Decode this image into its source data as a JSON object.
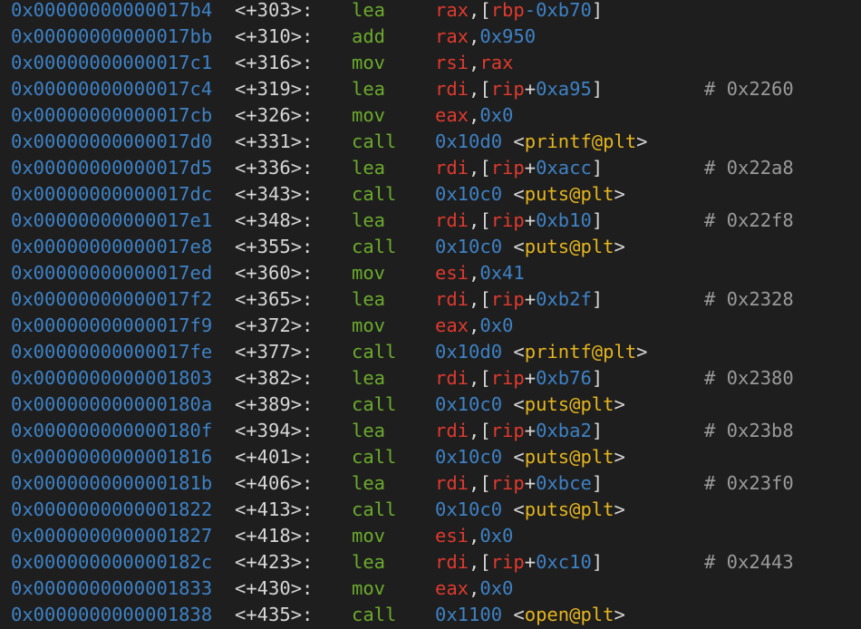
{
  "colors": {
    "background": "#1e1e1e",
    "address": "#3e82c6",
    "offset": "#d6d6d6",
    "mnemonic": "#6bab2c",
    "register": "#e03a2e",
    "number": "#3e82c6",
    "symbol": "#e5b51e",
    "comment": "#9a9a9a"
  },
  "lines": [
    {
      "addr": "0x00000000000017b4",
      "off": "<+303>:",
      "mn": "lea",
      "ops": [
        [
          "reg",
          "rax"
        ],
        [
          "punc",
          ",["
        ],
        [
          "reg",
          "rbp"
        ],
        [
          "num",
          "-0xb70"
        ],
        [
          "punc",
          "]"
        ]
      ],
      "cmt": ""
    },
    {
      "addr": "0x00000000000017bb",
      "off": "<+310>:",
      "mn": "add",
      "ops": [
        [
          "reg",
          "rax"
        ],
        [
          "punc",
          ","
        ],
        [
          "num",
          "0x950"
        ]
      ],
      "cmt": ""
    },
    {
      "addr": "0x00000000000017c1",
      "off": "<+316>:",
      "mn": "mov",
      "ops": [
        [
          "reg",
          "rsi"
        ],
        [
          "punc",
          ","
        ],
        [
          "reg",
          "rax"
        ]
      ],
      "cmt": ""
    },
    {
      "addr": "0x00000000000017c4",
      "off": "<+319>:",
      "mn": "lea",
      "ops": [
        [
          "reg",
          "rdi"
        ],
        [
          "punc",
          ",["
        ],
        [
          "reg",
          "rip"
        ],
        [
          "punc",
          "+"
        ],
        [
          "num",
          "0xa95"
        ],
        [
          "punc",
          "]"
        ]
      ],
      "cmt": "# 0x2260"
    },
    {
      "addr": "0x00000000000017cb",
      "off": "<+326>:",
      "mn": "mov",
      "ops": [
        [
          "reg",
          "eax"
        ],
        [
          "punc",
          ","
        ],
        [
          "num",
          "0x0"
        ]
      ],
      "cmt": ""
    },
    {
      "addr": "0x00000000000017d0",
      "off": "<+331>:",
      "mn": "call",
      "ops": [
        [
          "num",
          "0x10d0"
        ],
        [
          "punc",
          " <"
        ],
        [
          "sym",
          "printf@plt"
        ],
        [
          "punc",
          ">"
        ]
      ],
      "cmt": ""
    },
    {
      "addr": "0x00000000000017d5",
      "off": "<+336>:",
      "mn": "lea",
      "ops": [
        [
          "reg",
          "rdi"
        ],
        [
          "punc",
          ",["
        ],
        [
          "reg",
          "rip"
        ],
        [
          "punc",
          "+"
        ],
        [
          "num",
          "0xacc"
        ],
        [
          "punc",
          "]"
        ]
      ],
      "cmt": "# 0x22a8"
    },
    {
      "addr": "0x00000000000017dc",
      "off": "<+343>:",
      "mn": "call",
      "ops": [
        [
          "num",
          "0x10c0"
        ],
        [
          "punc",
          " <"
        ],
        [
          "sym",
          "puts@plt"
        ],
        [
          "punc",
          ">"
        ]
      ],
      "cmt": ""
    },
    {
      "addr": "0x00000000000017e1",
      "off": "<+348>:",
      "mn": "lea",
      "ops": [
        [
          "reg",
          "rdi"
        ],
        [
          "punc",
          ",["
        ],
        [
          "reg",
          "rip"
        ],
        [
          "punc",
          "+"
        ],
        [
          "num",
          "0xb10"
        ],
        [
          "punc",
          "]"
        ]
      ],
      "cmt": "# 0x22f8"
    },
    {
      "addr": "0x00000000000017e8",
      "off": "<+355>:",
      "mn": "call",
      "ops": [
        [
          "num",
          "0x10c0"
        ],
        [
          "punc",
          " <"
        ],
        [
          "sym",
          "puts@plt"
        ],
        [
          "punc",
          ">"
        ]
      ],
      "cmt": ""
    },
    {
      "addr": "0x00000000000017ed",
      "off": "<+360>:",
      "mn": "mov",
      "ops": [
        [
          "reg",
          "esi"
        ],
        [
          "punc",
          ","
        ],
        [
          "num",
          "0x41"
        ]
      ],
      "cmt": ""
    },
    {
      "addr": "0x00000000000017f2",
      "off": "<+365>:",
      "mn": "lea",
      "ops": [
        [
          "reg",
          "rdi"
        ],
        [
          "punc",
          ",["
        ],
        [
          "reg",
          "rip"
        ],
        [
          "punc",
          "+"
        ],
        [
          "num",
          "0xb2f"
        ],
        [
          "punc",
          "]"
        ]
      ],
      "cmt": "# 0x2328"
    },
    {
      "addr": "0x00000000000017f9",
      "off": "<+372>:",
      "mn": "mov",
      "ops": [
        [
          "reg",
          "eax"
        ],
        [
          "punc",
          ","
        ],
        [
          "num",
          "0x0"
        ]
      ],
      "cmt": ""
    },
    {
      "addr": "0x00000000000017fe",
      "off": "<+377>:",
      "mn": "call",
      "ops": [
        [
          "num",
          "0x10d0"
        ],
        [
          "punc",
          " <"
        ],
        [
          "sym",
          "printf@plt"
        ],
        [
          "punc",
          ">"
        ]
      ],
      "cmt": ""
    },
    {
      "addr": "0x0000000000001803",
      "off": "<+382>:",
      "mn": "lea",
      "ops": [
        [
          "reg",
          "rdi"
        ],
        [
          "punc",
          ",["
        ],
        [
          "reg",
          "rip"
        ],
        [
          "punc",
          "+"
        ],
        [
          "num",
          "0xb76"
        ],
        [
          "punc",
          "]"
        ]
      ],
      "cmt": "# 0x2380"
    },
    {
      "addr": "0x000000000000180a",
      "off": "<+389>:",
      "mn": "call",
      "ops": [
        [
          "num",
          "0x10c0"
        ],
        [
          "punc",
          " <"
        ],
        [
          "sym",
          "puts@plt"
        ],
        [
          "punc",
          ">"
        ]
      ],
      "cmt": ""
    },
    {
      "addr": "0x000000000000180f",
      "off": "<+394>:",
      "mn": "lea",
      "ops": [
        [
          "reg",
          "rdi"
        ],
        [
          "punc",
          ",["
        ],
        [
          "reg",
          "rip"
        ],
        [
          "punc",
          "+"
        ],
        [
          "num",
          "0xba2"
        ],
        [
          "punc",
          "]"
        ]
      ],
      "cmt": "# 0x23b8"
    },
    {
      "addr": "0x0000000000001816",
      "off": "<+401>:",
      "mn": "call",
      "ops": [
        [
          "num",
          "0x10c0"
        ],
        [
          "punc",
          " <"
        ],
        [
          "sym",
          "puts@plt"
        ],
        [
          "punc",
          ">"
        ]
      ],
      "cmt": ""
    },
    {
      "addr": "0x000000000000181b",
      "off": "<+406>:",
      "mn": "lea",
      "ops": [
        [
          "reg",
          "rdi"
        ],
        [
          "punc",
          ",["
        ],
        [
          "reg",
          "rip"
        ],
        [
          "punc",
          "+"
        ],
        [
          "num",
          "0xbce"
        ],
        [
          "punc",
          "]"
        ]
      ],
      "cmt": "# 0x23f0"
    },
    {
      "addr": "0x0000000000001822",
      "off": "<+413>:",
      "mn": "call",
      "ops": [
        [
          "num",
          "0x10c0"
        ],
        [
          "punc",
          " <"
        ],
        [
          "sym",
          "puts@plt"
        ],
        [
          "punc",
          ">"
        ]
      ],
      "cmt": ""
    },
    {
      "addr": "0x0000000000001827",
      "off": "<+418>:",
      "mn": "mov",
      "ops": [
        [
          "reg",
          "esi"
        ],
        [
          "punc",
          ","
        ],
        [
          "num",
          "0x0"
        ]
      ],
      "cmt": ""
    },
    {
      "addr": "0x000000000000182c",
      "off": "<+423>:",
      "mn": "lea",
      "ops": [
        [
          "reg",
          "rdi"
        ],
        [
          "punc",
          ",["
        ],
        [
          "reg",
          "rip"
        ],
        [
          "punc",
          "+"
        ],
        [
          "num",
          "0xc10"
        ],
        [
          "punc",
          "]"
        ]
      ],
      "cmt": "# 0x2443"
    },
    {
      "addr": "0x0000000000001833",
      "off": "<+430>:",
      "mn": "mov",
      "ops": [
        [
          "reg",
          "eax"
        ],
        [
          "punc",
          ","
        ],
        [
          "num",
          "0x0"
        ]
      ],
      "cmt": ""
    },
    {
      "addr": "0x0000000000001838",
      "off": "<+435>:",
      "mn": "call",
      "ops": [
        [
          "num",
          "0x1100"
        ],
        [
          "punc",
          " <"
        ],
        [
          "sym",
          "open@plt"
        ],
        [
          "punc",
          ">"
        ]
      ],
      "cmt": ""
    }
  ]
}
